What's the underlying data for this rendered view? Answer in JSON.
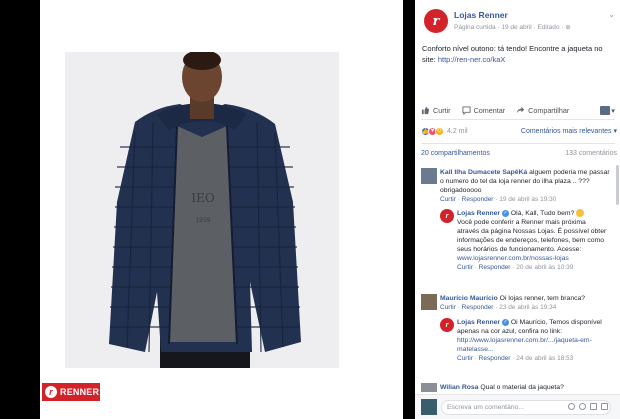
{
  "photo": {
    "brand_badge": "RENNER"
  },
  "post": {
    "page_name": "Lojas Renner",
    "meta": "Página curtida · 19 de abril · Editado · ",
    "text": "Conforto nível outono: tá tendo! Encontre a jaqueta no site: ",
    "link": "http://ren-ner.co/kaX",
    "actions": {
      "like": "Curtir",
      "comment": "Comentar",
      "share": "Compartilhar"
    },
    "reaction_count": "4,2 mil",
    "relevance": "Comentários mais relevantes ▾",
    "shares": "20 compartilhamentos",
    "comments_count": "133 comentários"
  },
  "comments": [
    {
      "name": "Kall Ilha Dumacete SapêKá",
      "text": " alguem poderia me passar o numero do tel da loja renner do ilha plaza .. ??? obrigadooooo",
      "like": "Curtir",
      "reply": "Responder",
      "time": "19 de abril às 19:30"
    },
    {
      "name": "Lojas Renner",
      "text": " Olá, Kall, Tudo bem? ",
      "text2": "Você pode conferir a Renner mais próxima através da página Nossas Lojas. É possível obter informações de endereços, telefones, bem como seus horários de funcionamento. Acesse: ",
      "link": "www.lojasrenner.com.br/nossas-lojas",
      "like": "Curtir",
      "reply": "Responder",
      "time": "20 de abril às 10:39"
    },
    {
      "name": "Maurício Maurício",
      "text": " Oi lojas renner, tem branca?",
      "like": "Curtir",
      "reply": "Responder",
      "time": "23 de abril às 19:34"
    },
    {
      "name": "Lojas Renner",
      "text": " Oi Maurício, Temos disponível apenas na cor azul, confira no link: ",
      "link": "http://www.lojasrenner.com.br/.../jaqueta-em-matelasse...",
      "like": "Curtir",
      "reply": "Responder",
      "time": "24 de abril às 18:53"
    },
    {
      "name": "Wilian Rosa",
      "text": " Qual o material da jaqueta?"
    }
  ],
  "composer": {
    "placeholder": "Escreva um comentário..."
  },
  "colors": {
    "brand_red": "#d2232a",
    "fb_link": "#365899",
    "jacket_navy": "#22314f"
  }
}
